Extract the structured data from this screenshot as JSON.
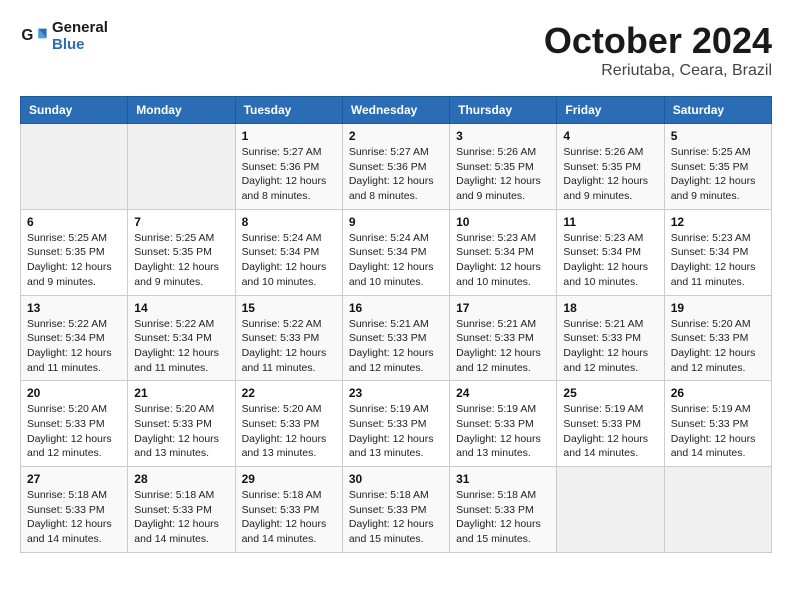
{
  "logo": {
    "line1": "General",
    "line2": "Blue"
  },
  "title": "October 2024",
  "subtitle": "Reriutaba, Ceara, Brazil",
  "days_of_week": [
    "Sunday",
    "Monday",
    "Tuesday",
    "Wednesday",
    "Thursday",
    "Friday",
    "Saturday"
  ],
  "weeks": [
    [
      {
        "day": "",
        "info": ""
      },
      {
        "day": "",
        "info": ""
      },
      {
        "day": "1",
        "info": "Sunrise: 5:27 AM\nSunset: 5:36 PM\nDaylight: 12 hours and 8 minutes."
      },
      {
        "day": "2",
        "info": "Sunrise: 5:27 AM\nSunset: 5:36 PM\nDaylight: 12 hours and 8 minutes."
      },
      {
        "day": "3",
        "info": "Sunrise: 5:26 AM\nSunset: 5:35 PM\nDaylight: 12 hours and 9 minutes."
      },
      {
        "day": "4",
        "info": "Sunrise: 5:26 AM\nSunset: 5:35 PM\nDaylight: 12 hours and 9 minutes."
      },
      {
        "day": "5",
        "info": "Sunrise: 5:25 AM\nSunset: 5:35 PM\nDaylight: 12 hours and 9 minutes."
      }
    ],
    [
      {
        "day": "6",
        "info": "Sunrise: 5:25 AM\nSunset: 5:35 PM\nDaylight: 12 hours and 9 minutes."
      },
      {
        "day": "7",
        "info": "Sunrise: 5:25 AM\nSunset: 5:35 PM\nDaylight: 12 hours and 9 minutes."
      },
      {
        "day": "8",
        "info": "Sunrise: 5:24 AM\nSunset: 5:34 PM\nDaylight: 12 hours and 10 minutes."
      },
      {
        "day": "9",
        "info": "Sunrise: 5:24 AM\nSunset: 5:34 PM\nDaylight: 12 hours and 10 minutes."
      },
      {
        "day": "10",
        "info": "Sunrise: 5:23 AM\nSunset: 5:34 PM\nDaylight: 12 hours and 10 minutes."
      },
      {
        "day": "11",
        "info": "Sunrise: 5:23 AM\nSunset: 5:34 PM\nDaylight: 12 hours and 10 minutes."
      },
      {
        "day": "12",
        "info": "Sunrise: 5:23 AM\nSunset: 5:34 PM\nDaylight: 12 hours and 11 minutes."
      }
    ],
    [
      {
        "day": "13",
        "info": "Sunrise: 5:22 AM\nSunset: 5:34 PM\nDaylight: 12 hours and 11 minutes."
      },
      {
        "day": "14",
        "info": "Sunrise: 5:22 AM\nSunset: 5:34 PM\nDaylight: 12 hours and 11 minutes."
      },
      {
        "day": "15",
        "info": "Sunrise: 5:22 AM\nSunset: 5:33 PM\nDaylight: 12 hours and 11 minutes."
      },
      {
        "day": "16",
        "info": "Sunrise: 5:21 AM\nSunset: 5:33 PM\nDaylight: 12 hours and 12 minutes."
      },
      {
        "day": "17",
        "info": "Sunrise: 5:21 AM\nSunset: 5:33 PM\nDaylight: 12 hours and 12 minutes."
      },
      {
        "day": "18",
        "info": "Sunrise: 5:21 AM\nSunset: 5:33 PM\nDaylight: 12 hours and 12 minutes."
      },
      {
        "day": "19",
        "info": "Sunrise: 5:20 AM\nSunset: 5:33 PM\nDaylight: 12 hours and 12 minutes."
      }
    ],
    [
      {
        "day": "20",
        "info": "Sunrise: 5:20 AM\nSunset: 5:33 PM\nDaylight: 12 hours and 12 minutes."
      },
      {
        "day": "21",
        "info": "Sunrise: 5:20 AM\nSunset: 5:33 PM\nDaylight: 12 hours and 13 minutes."
      },
      {
        "day": "22",
        "info": "Sunrise: 5:20 AM\nSunset: 5:33 PM\nDaylight: 12 hours and 13 minutes."
      },
      {
        "day": "23",
        "info": "Sunrise: 5:19 AM\nSunset: 5:33 PM\nDaylight: 12 hours and 13 minutes."
      },
      {
        "day": "24",
        "info": "Sunrise: 5:19 AM\nSunset: 5:33 PM\nDaylight: 12 hours and 13 minutes."
      },
      {
        "day": "25",
        "info": "Sunrise: 5:19 AM\nSunset: 5:33 PM\nDaylight: 12 hours and 14 minutes."
      },
      {
        "day": "26",
        "info": "Sunrise: 5:19 AM\nSunset: 5:33 PM\nDaylight: 12 hours and 14 minutes."
      }
    ],
    [
      {
        "day": "27",
        "info": "Sunrise: 5:18 AM\nSunset: 5:33 PM\nDaylight: 12 hours and 14 minutes."
      },
      {
        "day": "28",
        "info": "Sunrise: 5:18 AM\nSunset: 5:33 PM\nDaylight: 12 hours and 14 minutes."
      },
      {
        "day": "29",
        "info": "Sunrise: 5:18 AM\nSunset: 5:33 PM\nDaylight: 12 hours and 14 minutes."
      },
      {
        "day": "30",
        "info": "Sunrise: 5:18 AM\nSunset: 5:33 PM\nDaylight: 12 hours and 15 minutes."
      },
      {
        "day": "31",
        "info": "Sunrise: 5:18 AM\nSunset: 5:33 PM\nDaylight: 12 hours and 15 minutes."
      },
      {
        "day": "",
        "info": ""
      },
      {
        "day": "",
        "info": ""
      }
    ]
  ]
}
